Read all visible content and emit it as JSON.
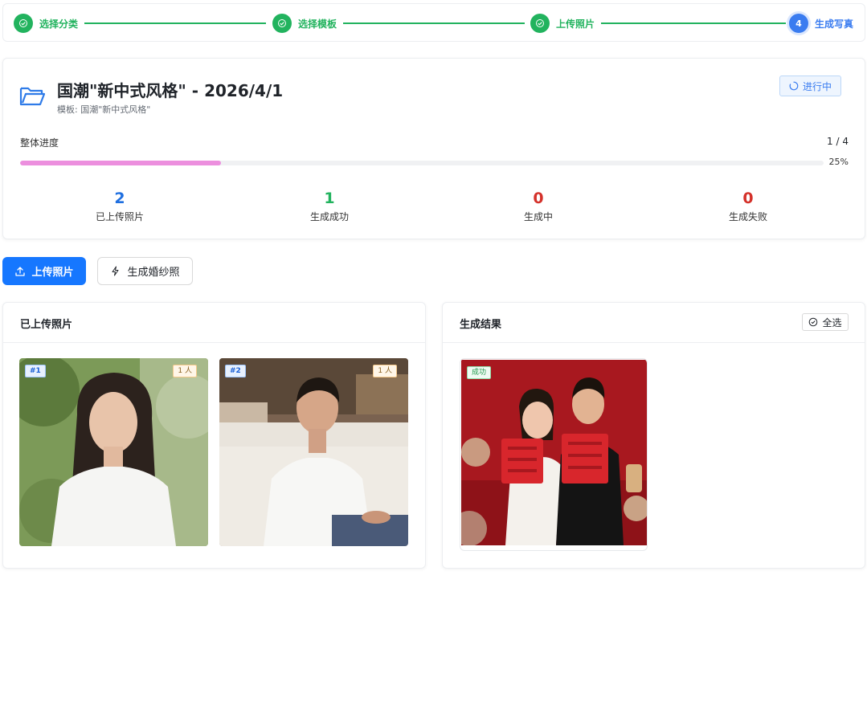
{
  "steps": [
    {
      "label": "选择分类",
      "state": "done"
    },
    {
      "label": "选择模板",
      "state": "done"
    },
    {
      "label": "上传照片",
      "state": "done"
    },
    {
      "label": "生成写真",
      "state": "active",
      "number": "4"
    }
  ],
  "task": {
    "title": "国潮\"新中式风格\" - 2026/4/1",
    "subtitle": "模板: 国潮\"新中式风格\"",
    "status": "进行中",
    "progress_label": "整体进度",
    "progress_count": "1 / 4",
    "progress_percent_text": "25%",
    "progress_fraction": 0.25,
    "stats": [
      {
        "value": "2",
        "label": "已上传照片",
        "color": "#1f6fe0"
      },
      {
        "value": "1",
        "label": "生成成功",
        "color": "#22b35e"
      },
      {
        "value": "0",
        "label": "生成中",
        "color": "#d4312a"
      },
      {
        "value": "0",
        "label": "生成失败",
        "color": "#d4312a"
      }
    ]
  },
  "actions": {
    "upload_label": "上传照片",
    "generate_label": "生成婚纱照"
  },
  "uploaded": {
    "title": "已上传照片",
    "photos": [
      {
        "num": "#1",
        "persons": "1 人"
      },
      {
        "num": "#2",
        "persons": "1 人"
      }
    ]
  },
  "results": {
    "title": "生成结果",
    "select_all": "全选",
    "items": [
      {
        "status": "成功"
      }
    ]
  },
  "colors": {
    "primary": "#1677ff",
    "success": "#22b35e",
    "progress": "#ec8fde",
    "danger": "#d4312a"
  }
}
